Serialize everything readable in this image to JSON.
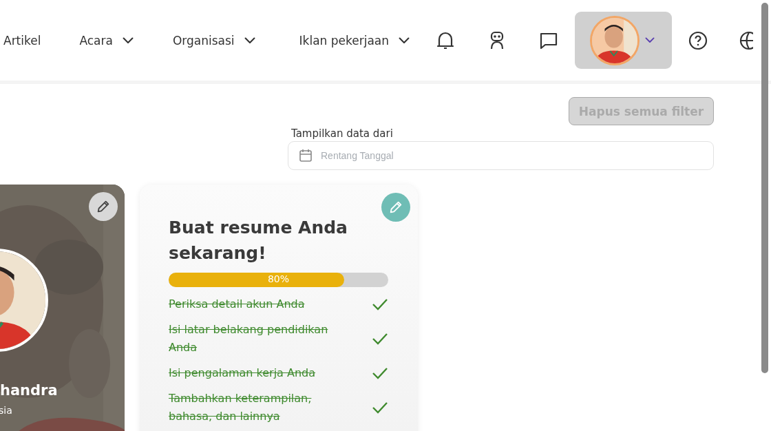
{
  "nav": {
    "links": [
      {
        "label": "Artikel",
        "dropdown": false
      },
      {
        "label": "Acara",
        "dropdown": true
      },
      {
        "label": "Organisasi",
        "dropdown": true
      },
      {
        "label": "Iklan pekerjaan",
        "dropdown": true
      }
    ]
  },
  "filters": {
    "clear_button": {
      "label": "Hapus semua filter",
      "disabled": true
    },
    "date_range": {
      "label": "Tampilkan data dari",
      "placeholder": "Rentang Tanggal"
    }
  },
  "profile_card": {
    "name": "handra",
    "subtitle": "sia"
  },
  "resume_card": {
    "title": "Buat resume Anda sekarang!",
    "progress": {
      "level": 0.8,
      "reading": "80%"
    },
    "tasks": [
      {
        "label": "Periksa detail akun Anda",
        "done": true
      },
      {
        "label": "Isi latar belakang pendidikan Anda",
        "done": true
      },
      {
        "label": "Isi pengalaman kerja Anda",
        "done": true
      },
      {
        "label": "Tambahkan keterampilan, bahasa, dan lainnya",
        "done": true
      }
    ]
  }
}
